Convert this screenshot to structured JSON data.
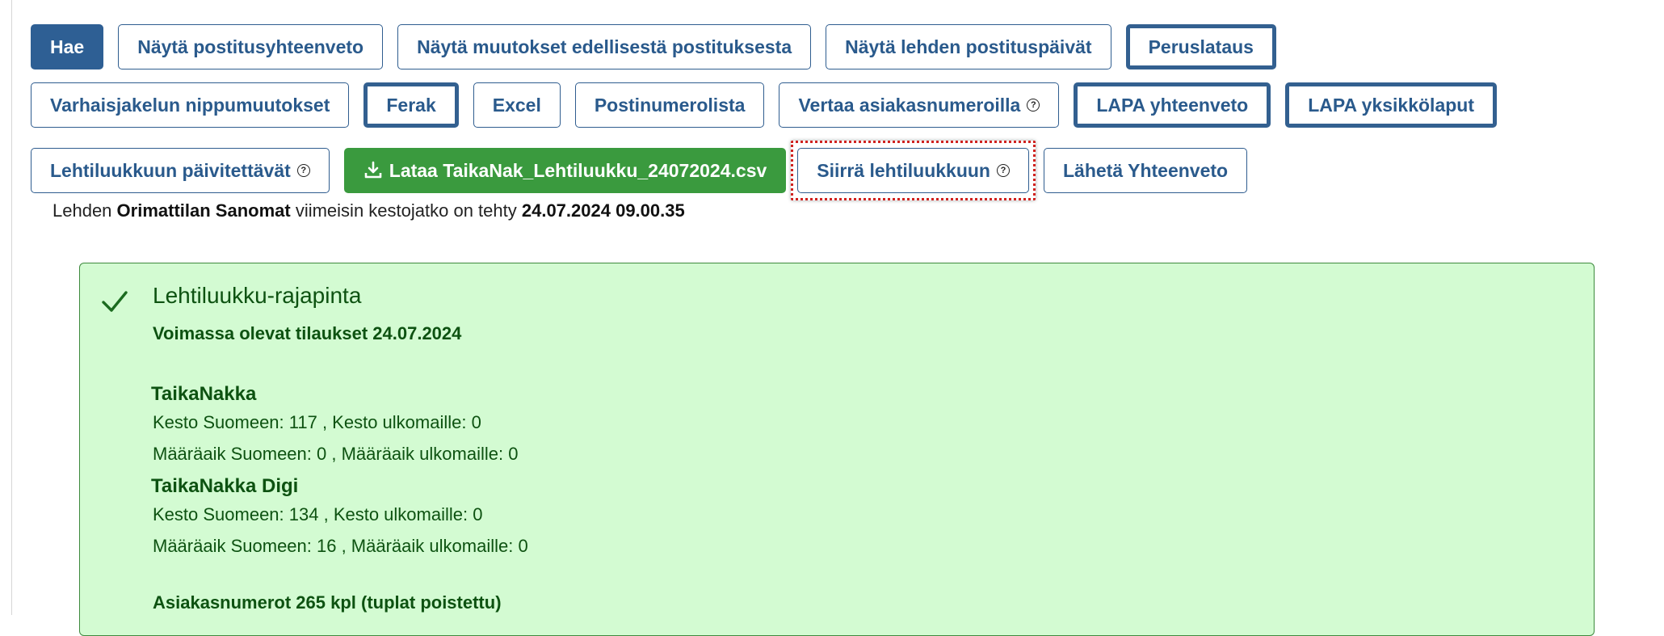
{
  "toolbar": {
    "row1": [
      {
        "label": "Hae",
        "style": "primary"
      },
      {
        "label": "Näytä postitusyhteenveto",
        "style": "outline"
      },
      {
        "label": "Näytä muutokset edellisestä postituksesta",
        "style": "outline"
      },
      {
        "label": "Näytä lehden postituspäivät",
        "style": "outline"
      },
      {
        "label": "Peruslataus",
        "style": "thick"
      }
    ],
    "row2": [
      {
        "label": "Varhaisjakelun nippumuutokset",
        "style": "outline"
      },
      {
        "label": "Ferak",
        "style": "thick"
      },
      {
        "label": "Excel",
        "style": "outline"
      },
      {
        "label": "Postinumerolista",
        "style": "outline"
      },
      {
        "label": "Vertaa asiakasnumeroilla",
        "style": "outline",
        "help": "?"
      },
      {
        "label": "LAPA yhteenveto",
        "style": "thick"
      },
      {
        "label": "LAPA yksikkölaput",
        "style": "thick"
      }
    ],
    "row3": {
      "lehtiluukku_label": "Lehtiluukkuun päivitettävät",
      "help": "?",
      "download_label": "Lataa TaikaNak_Lehtiluukku_24072024.csv",
      "siirra_label": "Siirrä lehtiluukkuun",
      "laheta_label": "Lähetä Yhteenveto"
    }
  },
  "info": {
    "prefix": "Lehden",
    "paper": "Orimattilan Sanomat",
    "middle": "viimeisin kestojatko on tehty",
    "datetime": "24.07.2024 09.00.35"
  },
  "panel": {
    "title": "Lehtiluukku-rajapinta",
    "subheading": "Voimassa olevat tilaukset 24.07.2024",
    "products": [
      {
        "name": "TaikaNakka",
        "line1": "Kesto Suomeen: 117 , Kesto ulkomaille: 0",
        "line2": "Määräaik Suomeen: 0 , Määräaik ulkomaille: 0"
      },
      {
        "name": "TaikaNakka Digi",
        "line1": "Kesto Suomeen: 134 , Kesto ulkomaille: 0",
        "line2": "Määräaik Suomeen: 16 , Määräaik ulkomaille: 0"
      }
    ],
    "asiakasnumerot": "Asiakasnumerot 265 kpl (tuplat poistettu)"
  },
  "colors": {
    "primary": "#2e5f94",
    "green": "#3a9a3e",
    "panel_bg": "#d3fbd2",
    "highlight": "#d0221f"
  }
}
